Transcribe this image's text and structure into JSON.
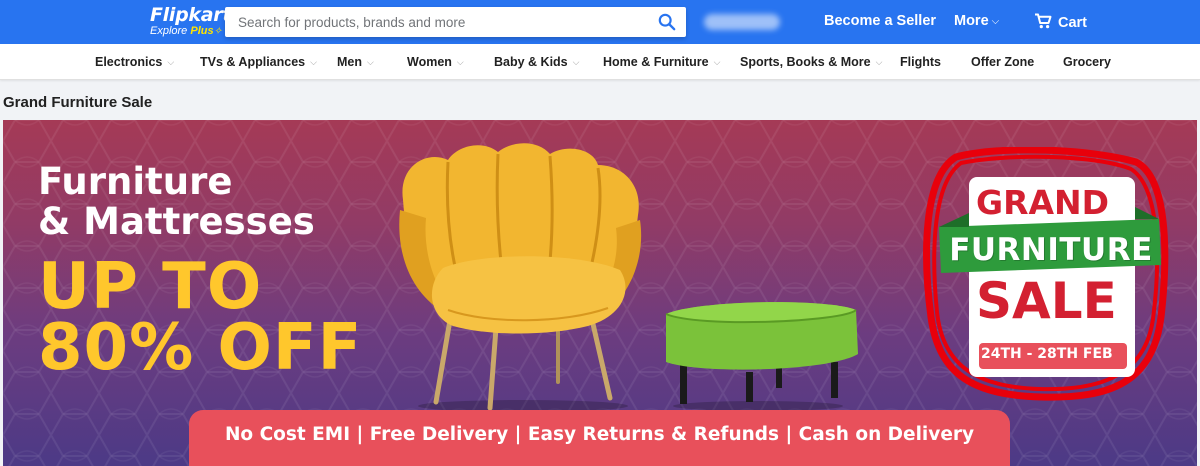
{
  "header": {
    "logo_text": "Flipkart",
    "logo_subtext": "Explore",
    "logo_plus": "Plus",
    "search_placeholder": "Search for products, brands and more",
    "become_seller": "Become a Seller",
    "more": "More",
    "cart": "Cart",
    "brand_color": "#2874f0",
    "accent_color": "#ffe500"
  },
  "nav": {
    "items": [
      {
        "label": "Electronics",
        "has_dropdown": true
      },
      {
        "label": "TVs & Appliances",
        "has_dropdown": true
      },
      {
        "label": "Men",
        "has_dropdown": true
      },
      {
        "label": "Women",
        "has_dropdown": true
      },
      {
        "label": "Baby & Kids",
        "has_dropdown": true
      },
      {
        "label": "Home & Furniture",
        "has_dropdown": true
      },
      {
        "label": "Sports, Books & More",
        "has_dropdown": true
      },
      {
        "label": "Flights",
        "has_dropdown": false
      },
      {
        "label": "Offer Zone",
        "has_dropdown": false
      },
      {
        "label": "Grocery",
        "has_dropdown": false
      }
    ]
  },
  "page": {
    "section_title": "Grand Furniture Sale"
  },
  "banner": {
    "heading_line1": "Furniture",
    "heading_line2": "& Mattresses",
    "offer_line1": "UP TO",
    "offer_line2": "80% OFF",
    "badge": {
      "line1": "GRAND",
      "line2": "FURNITURE",
      "line3": "SALE",
      "dates": "24TH - 28TH FEB"
    },
    "features": "No Cost EMI | Free Delivery | Easy Returns & Refunds | Cash on Delivery",
    "colors": {
      "offer_yellow": "#ffc72c",
      "badge_red": "#d32031",
      "badge_green": "#2e9b3c",
      "feature_bar": "#e8505b",
      "highlight_circle": "#e8000b"
    }
  }
}
